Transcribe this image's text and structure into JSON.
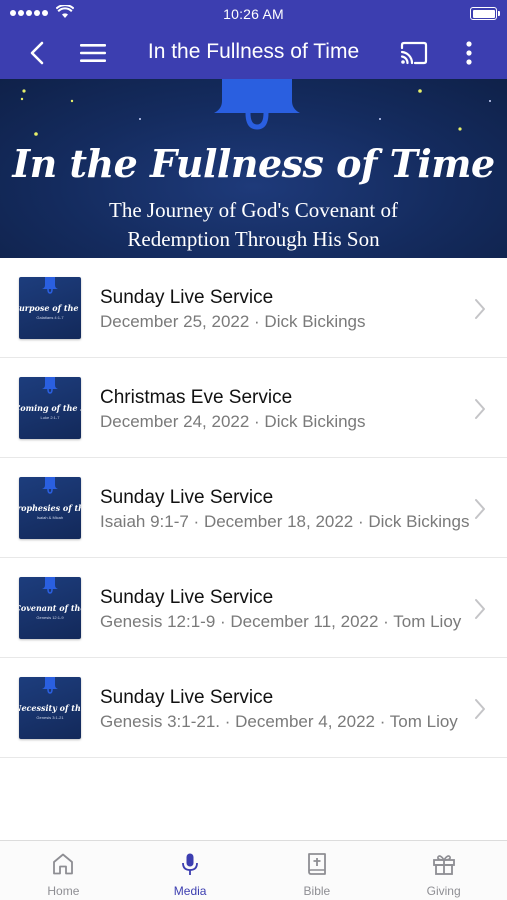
{
  "status_bar": {
    "time": "10:26 AM"
  },
  "nav": {
    "title": "In the Fullness of Time"
  },
  "banner": {
    "title": "In the Fullness of Time",
    "subtitle_line1": "The Journey of God's Covenant of",
    "subtitle_line2": "Redemption Through His Son"
  },
  "items": [
    {
      "title": "Sunday Live Service",
      "subtitle": "December 25, 2022 · Dick Bickings",
      "thumb_title": "Purpose of the S",
      "thumb_ref": "Galatians 4:1-7"
    },
    {
      "title": "Christmas Eve Service",
      "subtitle": "December 24, 2022 · Dick Bickings",
      "thumb_title": "Coming of the S",
      "thumb_ref": "Luke 2:1-7"
    },
    {
      "title": "Sunday Live Service",
      "subtitle": "Isaiah 9:1-7 · December 18, 2022 · Dick Bickings",
      "thumb_title": "Prophesies of the",
      "thumb_ref": "Isaiah & Micah"
    },
    {
      "title": "Sunday Live Service",
      "subtitle": "Genesis 12:1-9 · December 11, 2022 · Tom Lioy",
      "thumb_title": "Covenant of the",
      "thumb_ref": "Genesis 12:1-9"
    },
    {
      "title": "Sunday Live Service",
      "subtitle": "Genesis 3:1-21. · December 4, 2022 · Tom Lioy",
      "thumb_title": "Necessity of the",
      "thumb_ref": "Genesis 3:1-21"
    }
  ],
  "tabs": [
    {
      "label": "Home",
      "icon": "home-icon"
    },
    {
      "label": "Media",
      "icon": "microphone-icon"
    },
    {
      "label": "Bible",
      "icon": "bible-icon"
    },
    {
      "label": "Giving",
      "icon": "gift-icon"
    }
  ],
  "active_tab": "Media",
  "colors": {
    "accent": "#3c3eb0",
    "banner_bg": "#142b5e",
    "subtitle_gray": "#7a7a7a"
  }
}
